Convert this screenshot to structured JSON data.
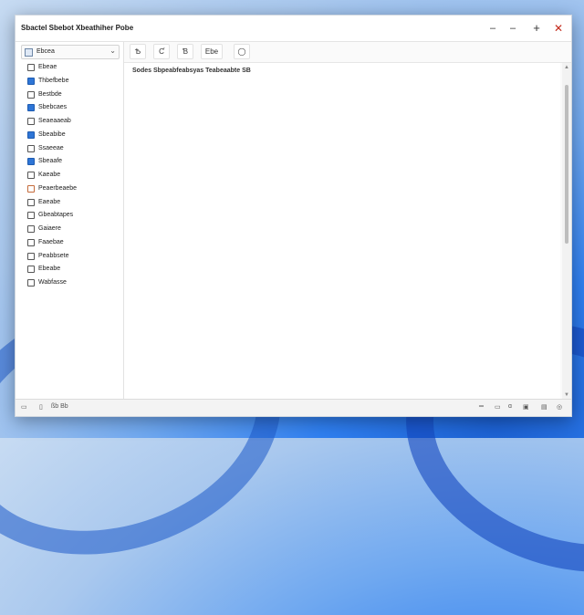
{
  "window": {
    "title": "Sbactel Sbebot Xbeathiher Pobe"
  },
  "sidebar": {
    "combo_label": "Ebcea",
    "items": [
      {
        "label": "Ebeae",
        "icon": "document-icon"
      },
      {
        "label": "Thbefbebe",
        "icon": "document-icon"
      },
      {
        "label": "Bestbde",
        "icon": "image-icon"
      },
      {
        "label": "Sbebcaes",
        "icon": "app-icon"
      },
      {
        "label": "Seaeaaeab",
        "icon": "search-icon"
      },
      {
        "label": "Sbeabibe",
        "icon": "window-icon"
      },
      {
        "label": "Ssaeeae",
        "icon": "page-icon"
      },
      {
        "label": "Sbeaafe",
        "icon": "app-icon"
      },
      {
        "label": "Kaeabe",
        "icon": "page-icon"
      },
      {
        "label": "Peaerbeaebe",
        "icon": "chart-icon"
      },
      {
        "label": "Eaeabe",
        "icon": "list-icon"
      },
      {
        "label": "Gbeabtapes",
        "icon": "text-icon"
      },
      {
        "label": "Gaiaere",
        "icon": "page-icon"
      },
      {
        "label": "Faaebae",
        "icon": "window-icon"
      },
      {
        "label": "Peabbsete",
        "icon": "folder-icon"
      },
      {
        "label": "Ebeabe",
        "icon": "image-icon"
      },
      {
        "label": "Wabfasse",
        "icon": "document-icon"
      }
    ]
  },
  "toolbar": {
    "btn1": "Ѣ",
    "btn2": "Ƈ",
    "btn3": "Ɓ",
    "btn4": "Ebe",
    "btn5": "◯"
  },
  "content": {
    "text": "Sodes Sbpeabfeabsyas Teabeaabte SB"
  },
  "statusbar": {
    "left_text": "ßb Bb",
    "right_icons": [
      "lines-icon",
      "box-icon",
      "brush-icon",
      "picture-icon",
      "monitor-icon",
      "globe-icon"
    ]
  }
}
